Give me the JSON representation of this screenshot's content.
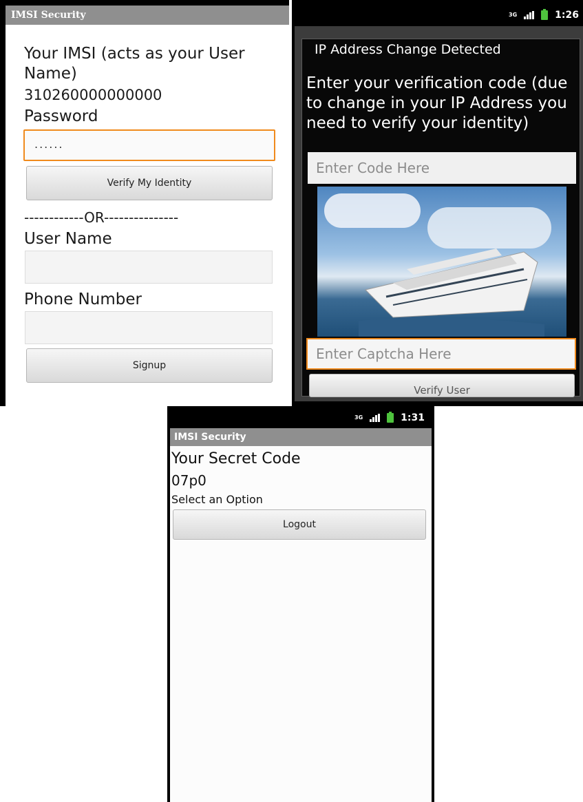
{
  "login_screen": {
    "app_title": "IMSI Security",
    "imsi_label": "Your IMSI (acts as your User Name)",
    "imsi_value": "310260000000000",
    "password_label": "Password",
    "password_value": "......",
    "verify_button": "Verify My Identity",
    "or_separator": "------------OR---------------",
    "username_label": "User Name",
    "username_value": "",
    "phone_label": "Phone Number",
    "phone_value": "",
    "signup_button": "Signup"
  },
  "ip_dialog_screen": {
    "status_time": "1:26",
    "status_network": "3G",
    "dialog_title": "IP Address Change Detected",
    "message": "Enter your verification code (due to change in your IP Address you need to verify your identity)",
    "code_placeholder": "Enter Code Here",
    "captcha_image": "cruise-ship-image",
    "captcha_placeholder": "Enter Captcha Here",
    "verify_button": "Verify User"
  },
  "secret_screen": {
    "status_time": "1:31",
    "status_network": "3G",
    "app_title": "IMSI Security",
    "secret_label": "Your Secret Code",
    "secret_value": "07p0",
    "option_label": "Select an Option",
    "logout_button": "Logout"
  },
  "colors": {
    "titlebar": "#8f8f8f",
    "focus_border": "#f08a1c",
    "battery": "#4ec33d"
  }
}
